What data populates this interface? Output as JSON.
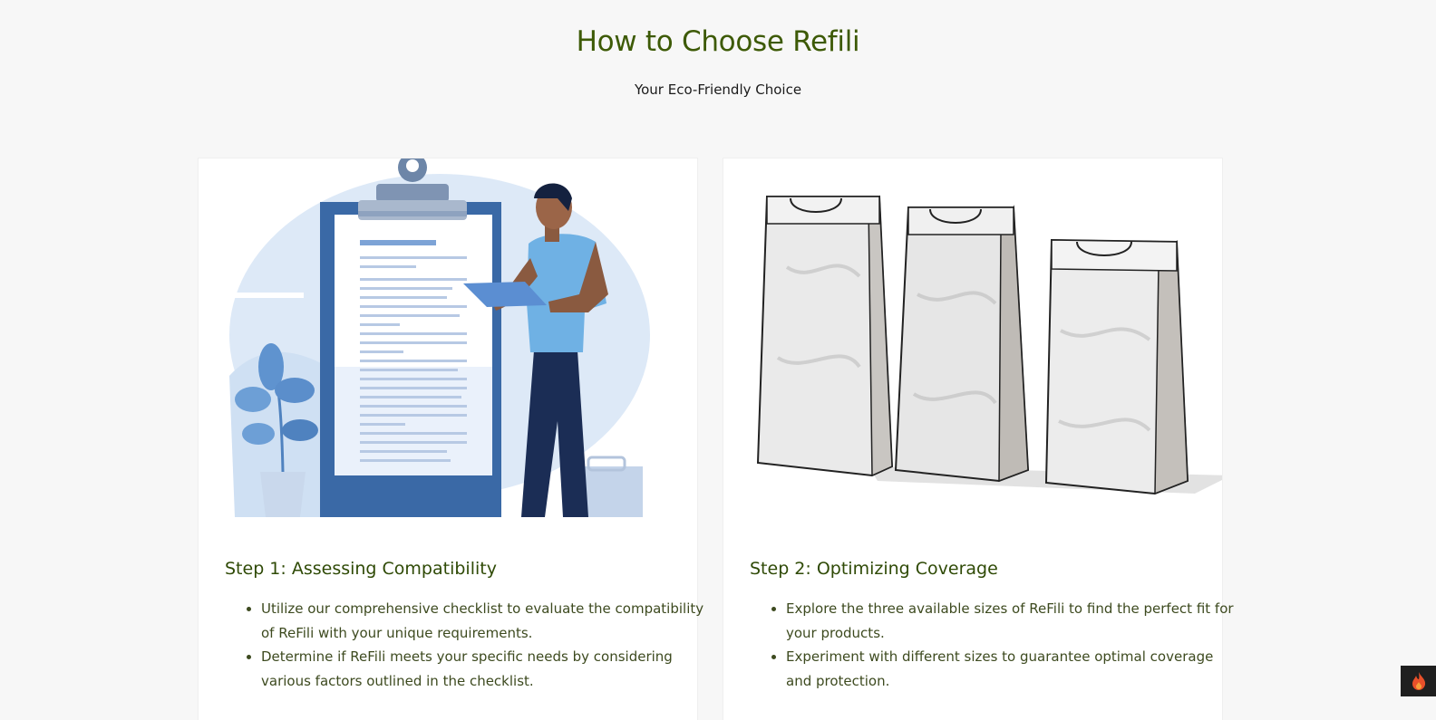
{
  "hero": {
    "title": "How to Choose Refili",
    "subtitle": "Your Eco-Friendly Choice"
  },
  "cards": [
    {
      "image_icon": "checklist-illustration",
      "title": "Step 1: Assessing Compatibility",
      "bullets": [
        "Utilize our comprehensive checklist to evaluate the compatibility of ReFili with your unique requirements.",
        "Determine if ReFili meets your specific needs by considering various factors outlined in the checklist."
      ]
    },
    {
      "image_icon": "refill-bags-illustration",
      "title": "Step 2: Optimizing Coverage",
      "bullets": [
        "Explore the three available sizes of ReFili to find the perfect fit for your products.",
        "Experiment with different sizes to guarantee optimal coverage and protection."
      ]
    }
  ],
  "widget": {
    "icon": "flame-icon"
  },
  "colors": {
    "heading": "#3d5a06",
    "page_background": "#f7f7f7",
    "illustration_blue": "#3e6ea8"
  }
}
